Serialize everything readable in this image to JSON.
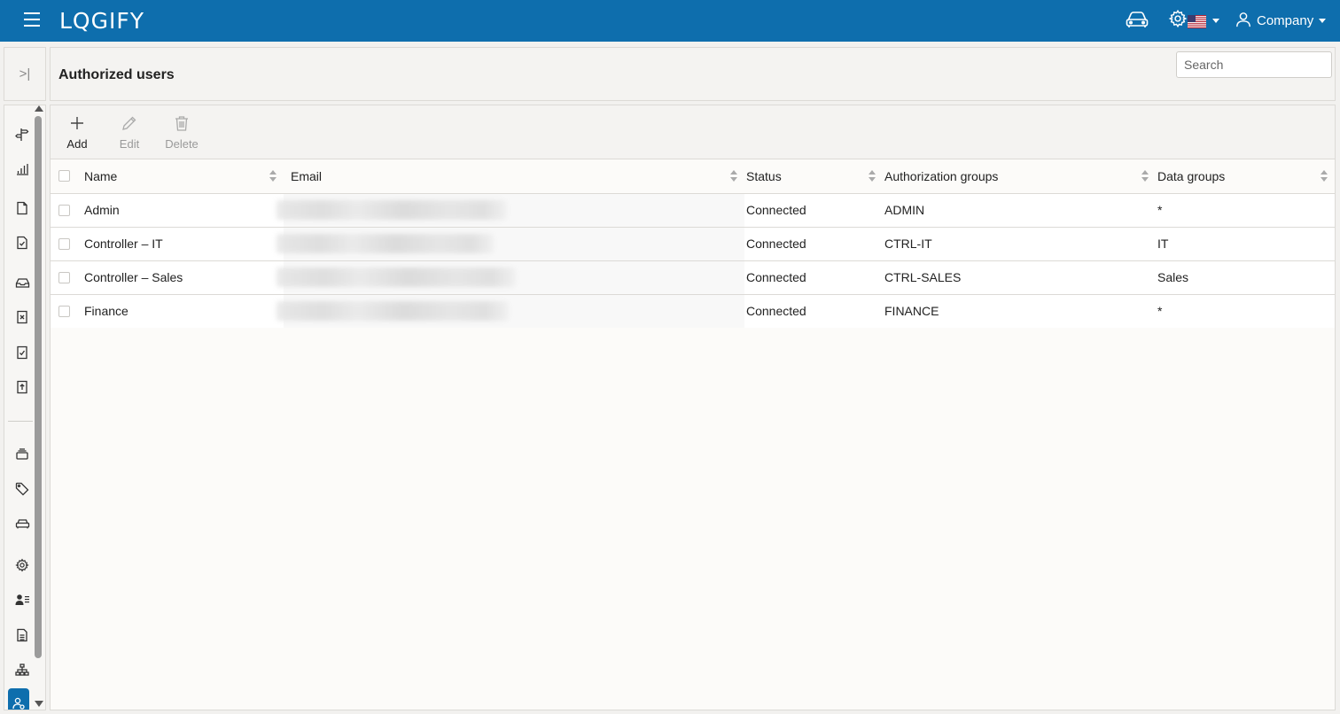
{
  "app": {
    "logo_text": "LQGIFY"
  },
  "topbar": {
    "icons": [
      "menu-icon",
      "car-icon",
      "gear-icon",
      "us-flag-icon",
      "user-icon"
    ],
    "company_label": "Company"
  },
  "header": {
    "title": "Authorized users",
    "search_placeholder": "Search"
  },
  "toolbar": {
    "add_label": "Add",
    "edit_label": "Edit",
    "delete_label": "Delete"
  },
  "table": {
    "columns": [
      "Name",
      "Email",
      "Status",
      "Authorization groups",
      "Data groups"
    ],
    "rows": [
      {
        "name": "Admin",
        "status": "Connected",
        "auth_groups": "ADMIN",
        "data_groups": "*"
      },
      {
        "name": "Controller – IT",
        "status": "Connected",
        "auth_groups": "CTRL-IT",
        "data_groups": "IT"
      },
      {
        "name": "Controller – Sales",
        "status": "Connected",
        "auth_groups": "CTRL-SALES",
        "data_groups": "Sales"
      },
      {
        "name": "Finance",
        "status": "Connected",
        "auth_groups": "FINANCE",
        "data_groups": "*"
      }
    ]
  },
  "rail": {
    "icons": [
      "signpost-icon",
      "bar-chart-icon",
      "document-icon",
      "document-check-icon",
      "inbox-icon",
      "document-x-icon",
      "document-checklist-icon",
      "document-upload-icon",
      "layers-icon",
      "tag-icon",
      "car-icon",
      "settings-icon",
      "users-list-icon",
      "file-list-icon",
      "org-chart-icon",
      "user-settings-icon"
    ]
  },
  "colors": {
    "brand": "#0e6ead",
    "background": "#f2f1ef"
  }
}
